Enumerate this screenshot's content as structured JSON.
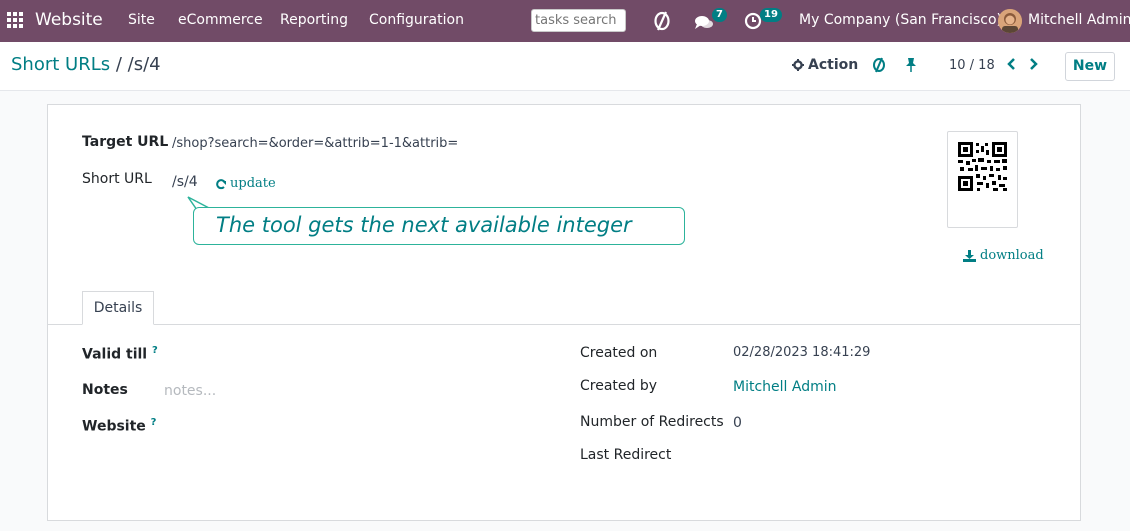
{
  "navbar": {
    "brand": "Website",
    "menu": [
      "Site",
      "eCommerce",
      "Reporting",
      "Configuration"
    ],
    "search_placeholder": "tasks search",
    "messages_count": "7",
    "activities_count": "19",
    "company": "My Company (San Francisco)",
    "user": "Mitchell Admin",
    "icons": [
      "apps-grid-icon",
      "sync-icon",
      "chat-icon",
      "clock-icon"
    ]
  },
  "control": {
    "breadcrumb_parent": "Short URLs",
    "breadcrumb_sep": "/",
    "breadcrumb_current": "/s/4",
    "action_label": "Action",
    "pager": "10 / 18",
    "new_label": "New"
  },
  "form": {
    "target_url_label": "Target URL",
    "target_url_value": "/shop?search=&order=&attrib=1-1&attrib=",
    "short_url_label": "Short URL",
    "short_url_value": "/s/4",
    "update_label": "update",
    "download_label": "download",
    "tab_details": "Details",
    "valid_till_label": "Valid till",
    "help_mark": "?",
    "notes_label": "Notes",
    "notes_placeholder": "notes...",
    "website_label": "Website",
    "created_on_label": "Created on",
    "created_on_value": "02/28/2023 18:41:29",
    "created_by_label": "Created by",
    "created_by_value": "Mitchell Admin",
    "redirects_label": "Number of Redirects",
    "redirects_value": "0",
    "last_redirect_label": "Last Redirect"
  },
  "callout": {
    "text": "The tool gets the next available integer"
  },
  "colors": {
    "navbar": "#714b67",
    "accent": "#017e84",
    "callout_border": "#2db39b"
  }
}
